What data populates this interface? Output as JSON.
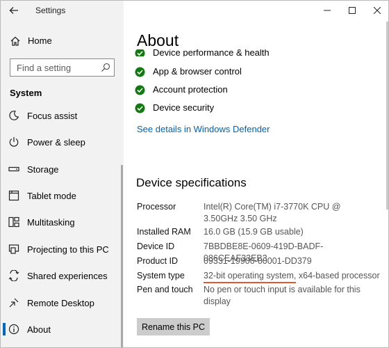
{
  "window": {
    "title": "Settings"
  },
  "sidebar": {
    "home_label": "Home",
    "search_placeholder": "Find a setting",
    "section": "System",
    "items": [
      {
        "label": "Focus assist",
        "icon": "moon-icon"
      },
      {
        "label": "Power & sleep",
        "icon": "power-icon"
      },
      {
        "label": "Storage",
        "icon": "storage-icon"
      },
      {
        "label": "Tablet mode",
        "icon": "tablet-mode-icon"
      },
      {
        "label": "Multitasking",
        "icon": "multitasking-icon"
      },
      {
        "label": "Projecting to this PC",
        "icon": "projecting-icon"
      },
      {
        "label": "Shared experiences",
        "icon": "shared-experiences-icon"
      },
      {
        "label": "Remote Desktop",
        "icon": "remote-desktop-icon"
      },
      {
        "label": "About",
        "icon": "info-icon",
        "selected": true
      }
    ]
  },
  "main": {
    "title": "About",
    "protection_items": [
      {
        "label": "Device performance & health",
        "clipped": true
      },
      {
        "label": "App & browser control"
      },
      {
        "label": "Account protection"
      },
      {
        "label": "Device security"
      }
    ],
    "defender_link": "See details in Windows Defender",
    "specs_heading": "Device specifications",
    "specs": [
      {
        "label": "Processor",
        "value": "Intel(R) Core(TM) i7-3770K CPU @ 3.50GHz 3.50 GHz"
      },
      {
        "label": "Installed RAM",
        "value": "16.0 GB (15.9 GB usable)"
      },
      {
        "label": "Device ID",
        "value": "7BBDBE8E-0609-419D-BADF-086CEAF33EB3"
      },
      {
        "label": "Product ID",
        "value": "09331-19900-00001-DD379"
      },
      {
        "label": "System type",
        "value": "32-bit operating system, x64-based processor"
      },
      {
        "label": "Pen and touch",
        "value": "No pen or touch input is available for this display"
      }
    ],
    "rename_button": "Rename this PC"
  },
  "colors": {
    "accent": "#0067c0",
    "link": "#0063b1",
    "check_green": "#107c10",
    "highlight_underline": "#e4572e",
    "sidebar_bg": "#f2f2f2"
  }
}
